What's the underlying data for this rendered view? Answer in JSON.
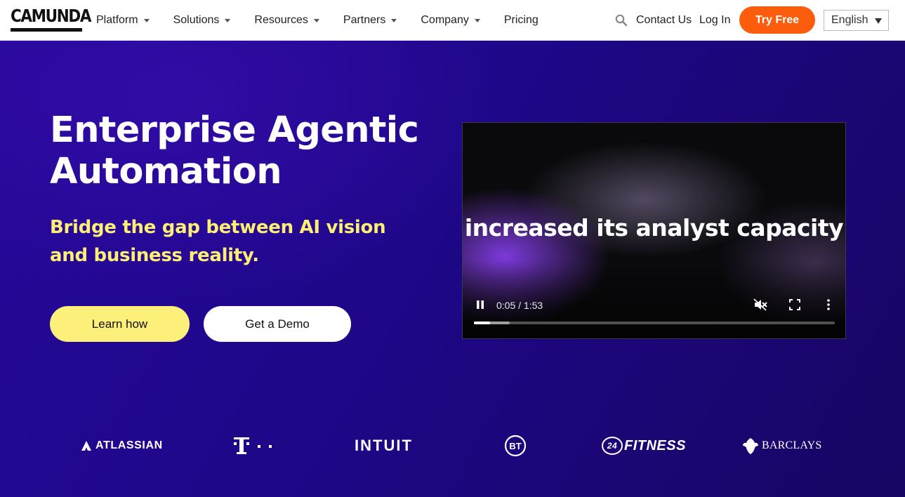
{
  "brand": {
    "logo_text": "CAMUNDA"
  },
  "nav": {
    "items": [
      {
        "label": "Platform",
        "has_dropdown": true
      },
      {
        "label": "Solutions",
        "has_dropdown": true
      },
      {
        "label": "Resources",
        "has_dropdown": true
      },
      {
        "label": "Partners",
        "has_dropdown": true
      },
      {
        "label": "Company",
        "has_dropdown": true
      },
      {
        "label": "Pricing",
        "has_dropdown": false
      }
    ],
    "contact_label": "Contact Us",
    "login_label": "Log In",
    "try_free_label": "Try Free",
    "language_selected": "English",
    "search_icon": "search-icon"
  },
  "hero": {
    "title": "Enterprise Agentic Automation",
    "subtitle": "Bridge the gap between AI vision and business reality.",
    "primary_cta": "Learn how",
    "secondary_cta": "Get a Demo"
  },
  "video": {
    "caption": "increased its analyst capacity",
    "time_display": "0:05 / 1:53",
    "progress_fraction": 0.044,
    "buffered_fraction": 0.1
  },
  "customers": {
    "atlassian": "ATLASSIAN",
    "telekom": "T · ·",
    "intuit": "INTUIT",
    "bt": "BT",
    "fitness_badge": "24",
    "fitness": "FITNESS",
    "barclays": "BARCLAYS"
  },
  "colors": {
    "accent_orange": "#fc5d0d",
    "accent_yellow": "#fcf07a",
    "hero_bg": "#22078f",
    "subtitle_yellow": "#fcef74"
  }
}
